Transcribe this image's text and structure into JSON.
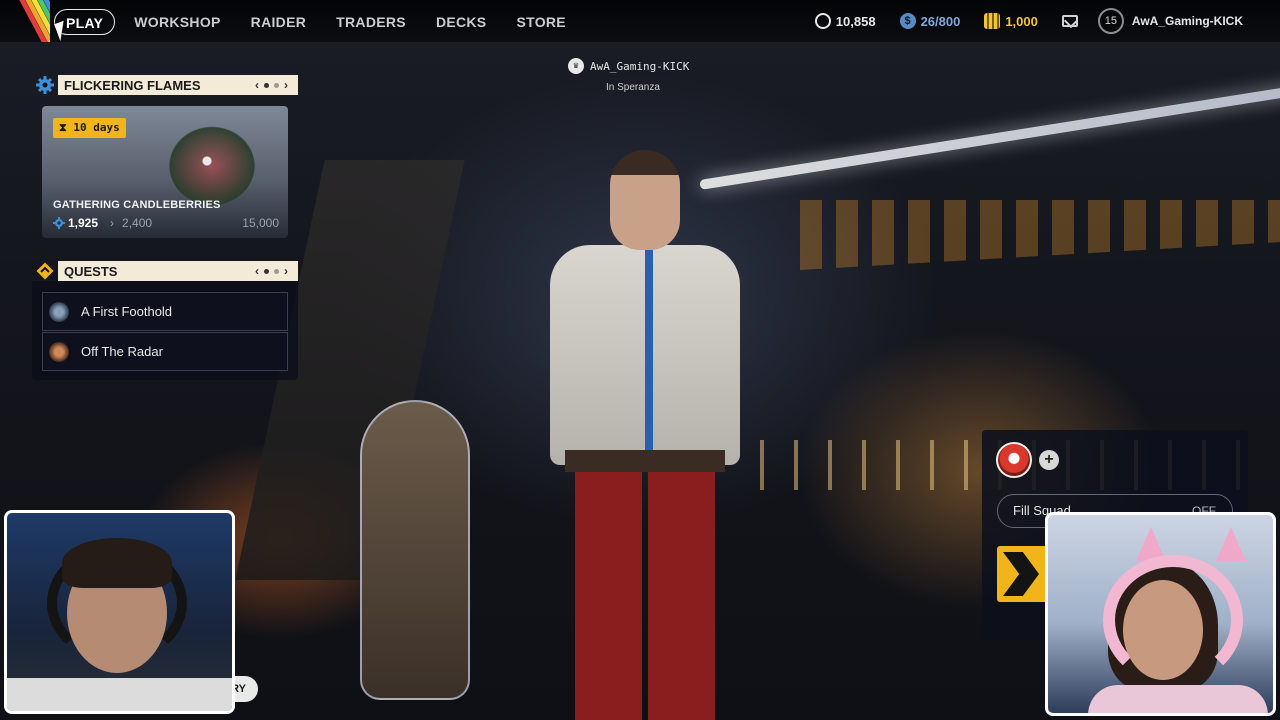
{
  "nav": {
    "items": [
      {
        "label": "PLAY",
        "active": true
      },
      {
        "label": "WORKSHOP",
        "active": false
      },
      {
        "label": "RAIDER",
        "active": false
      },
      {
        "label": "TRADERS",
        "active": false
      },
      {
        "label": "DECKS",
        "active": false
      },
      {
        "label": "STORE",
        "active": false
      }
    ]
  },
  "currencies": {
    "coins": {
      "value": "10,858",
      "icon": "coin-icon"
    },
    "tokens": {
      "value": "26/800",
      "icon": "token-icon",
      "color": "#7fa8d8"
    },
    "gold": {
      "value": "1,000",
      "icon": "gold-bars-icon",
      "color": "#f0c43a"
    }
  },
  "profile": {
    "level": "15",
    "username": "AwA_Gaming-KICK"
  },
  "player_tag": {
    "name": "AwA_Gaming-KICK",
    "location": "In Speranza"
  },
  "event": {
    "header": "FLICKERING FLAMES",
    "badge": "10 days",
    "title": "GATHERING CANDLEBERRIES",
    "current": "1,925",
    "next": "2,400",
    "max": "15,000",
    "accent": "#f1b51b"
  },
  "quests": {
    "header": "QUESTS",
    "items": [
      {
        "label": "A First Foothold"
      },
      {
        "label": "Off The Radar"
      }
    ]
  },
  "squad": {
    "fill_label": "Fill Squad",
    "fill_value": "OFF"
  },
  "bottom_button": {
    "label": "RY"
  }
}
